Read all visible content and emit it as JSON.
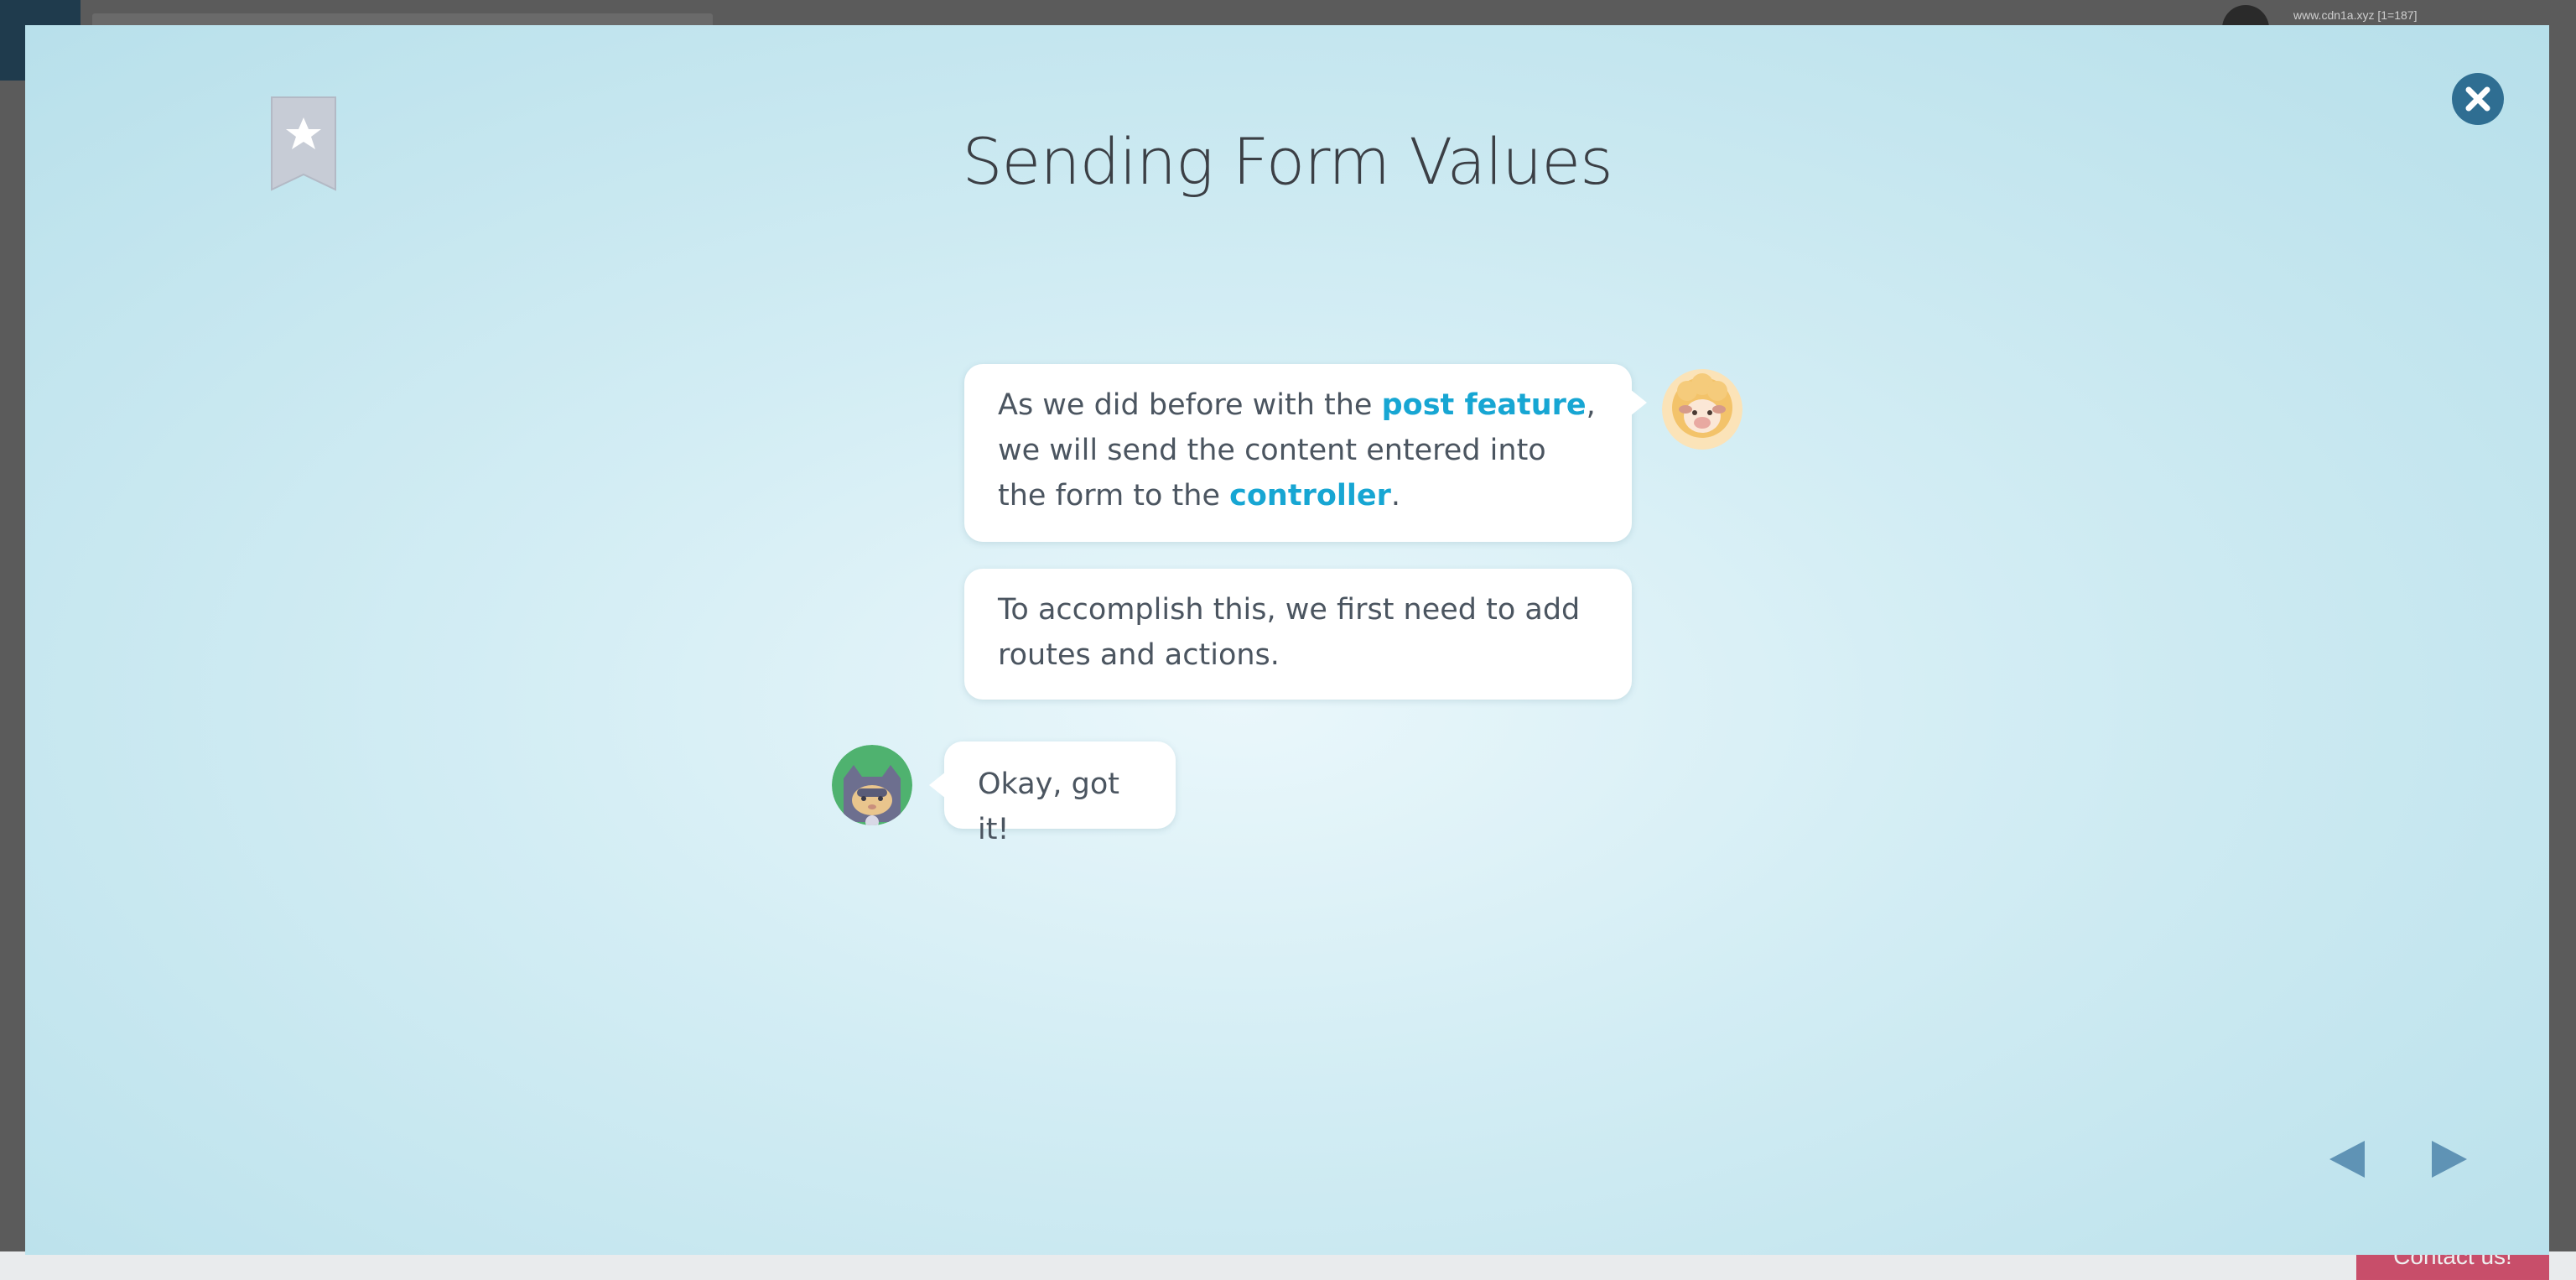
{
  "background": {
    "user_info": "www.cdn1a.xyz [1=187]",
    "contact_label": "Contact us!"
  },
  "modal": {
    "title": "Sending Form Values",
    "messages": [
      {
        "speaker": "sheep",
        "parts": {
          "p1": "As we did before with the ",
          "h1": "post feature",
          "p2": ", we will send the content entered into the form to the ",
          "h2": "controller",
          "p3": "."
        }
      },
      {
        "speaker": "sheep",
        "text": "To accomplish this, we first need to add routes and actions."
      },
      {
        "speaker": "cat",
        "text": "Okay, got it!"
      }
    ],
    "colors": {
      "highlight": "#17a6d3",
      "close_button": "#2f6e92",
      "nav_arrow": "#5f93b5",
      "bookmark": "#c7ccd6"
    },
    "icons": {
      "bookmark": "bookmark-star-icon",
      "close": "close-circle-icon",
      "prev": "triangle-left-icon",
      "next": "triangle-right-icon"
    }
  }
}
